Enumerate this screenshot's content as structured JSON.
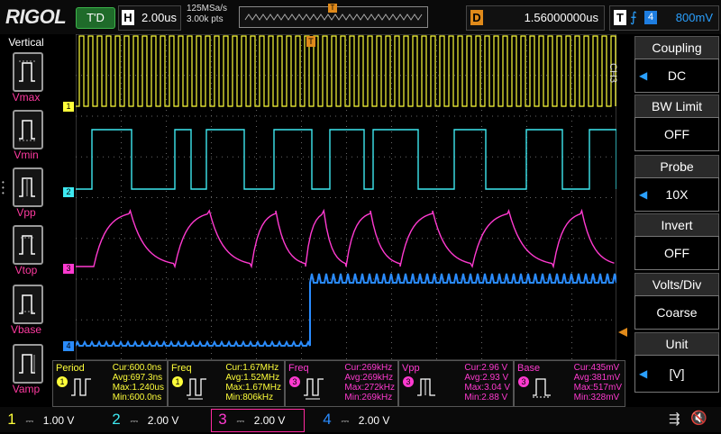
{
  "header": {
    "brand": "RIGOL",
    "run_state": "T'D",
    "horizontal_key": "H",
    "timebase": "2.00us",
    "sample_rate": "125MSa/s",
    "memory_depth": "3.00k pts",
    "trigger_marker": "T",
    "delay_key": "D",
    "delay_value": "1.56000000us",
    "trigger_key": "T",
    "trigger_source": "4",
    "trigger_level": "800mV"
  },
  "left_menu": {
    "title": "Vertical",
    "items": [
      {
        "label": "Vmax"
      },
      {
        "label": "Vmin"
      },
      {
        "label": "Vpp"
      },
      {
        "label": "Vtop"
      },
      {
        "label": "Vbase"
      },
      {
        "label": "Vamp"
      }
    ]
  },
  "right_menu": {
    "channel_tag": "CH3",
    "items": [
      {
        "title": "Coupling",
        "value": "DC"
      },
      {
        "title": "BW Limit",
        "value": "OFF"
      },
      {
        "title": "Probe",
        "value": "10X"
      },
      {
        "title": "Invert",
        "value": "OFF"
      },
      {
        "title": "Volts/Div",
        "value": "Coarse"
      },
      {
        "title": "Unit",
        "value": "[V]"
      }
    ]
  },
  "channel_markers": {
    "ch1": "1",
    "ch2": "2",
    "ch3": "3",
    "ch4": "4"
  },
  "measurements": [
    {
      "name": "Period",
      "source": "1",
      "cur": "Cur:600.0ns",
      "avg": "Avg:697.3ns",
      "max": "Max:1.240us",
      "min": "Min:600.0ns",
      "color": "#ffff3a"
    },
    {
      "name": "Freq",
      "source": "1",
      "cur": "Cur:1.67MHz",
      "avg": "Avg:1.52MHz",
      "max": "Max:1.67MHz",
      "min": "Min:806kHz",
      "color": "#ffff3a"
    },
    {
      "name": "Freq",
      "source": "3",
      "cur": "Cur:269kHz",
      "avg": "Avg:269kHz",
      "max": "Max:272kHz",
      "min": "Min:269kHz",
      "color": "#ff3ad0"
    },
    {
      "name": "Vpp",
      "source": "3",
      "cur": "Cur:2.96 V",
      "avg": "Avg:2.93 V",
      "max": "Max:3.04 V",
      "min": "Min:2.88 V",
      "color": "#ff3ad0"
    },
    {
      "name": "Base",
      "source": "3",
      "cur": "Cur:435mV",
      "avg": "Avg:381mV",
      "max": "Max:517mV",
      "min": "Min:328mV",
      "color": "#ff3ad0"
    }
  ],
  "channels": [
    {
      "num": "1",
      "scale": "1.00 V",
      "color": "#ffff3a"
    },
    {
      "num": "2",
      "scale": "2.00 V",
      "color": "#3ee8f0"
    },
    {
      "num": "3",
      "scale": "2.00 V",
      "color": "#ff3ad0"
    },
    {
      "num": "4",
      "scale": "2.00 V",
      "color": "#2a8cff"
    }
  ],
  "colors": {
    "ch1": "#ffff3a",
    "ch2": "#3ee8f0",
    "ch3": "#ff3ad0",
    "ch4": "#2a8cff",
    "trigger": "#e08a1a"
  },
  "status_icons": [
    "usb-icon",
    "speaker-muted-icon"
  ]
}
